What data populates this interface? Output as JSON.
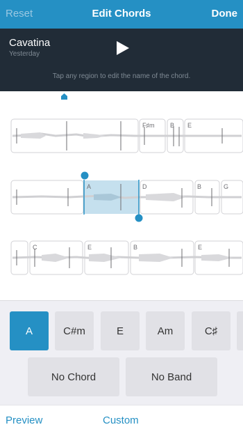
{
  "nav": {
    "reset_label": "Reset",
    "title": "Edit Chords",
    "done_label": "Done"
  },
  "player": {
    "song_title": "Cavatina",
    "song_subtitle": "Yesterday",
    "play_icon": "play-icon",
    "hint": "Tap any region to edit the name of the chord."
  },
  "waveform": {
    "rows": [
      {
        "segments": [
          {
            "label": ""
          },
          {
            "label": "F♯m"
          },
          {
            "label": "B"
          },
          {
            "label": "E"
          }
        ]
      },
      {
        "segments": [
          {
            "label": ""
          },
          {
            "label": "A",
            "selected": true
          },
          {
            "label": "D"
          },
          {
            "label": "B"
          },
          {
            "label": "G"
          }
        ]
      },
      {
        "segments": [
          {
            "label": ""
          },
          {
            "label": "C"
          },
          {
            "label": "E"
          },
          {
            "label": "B"
          },
          {
            "label": "E"
          }
        ]
      }
    ]
  },
  "picker": {
    "chords": [
      {
        "label": "A",
        "selected": true
      },
      {
        "label": "C#m"
      },
      {
        "label": "E"
      },
      {
        "label": "Am"
      },
      {
        "label": "C♯"
      }
    ],
    "no_chord_label": "No Chord",
    "no_band_label": "No Band"
  },
  "bottom": {
    "preview_label": "Preview",
    "custom_label": "Custom"
  },
  "colors": {
    "accent": "#2590c4",
    "selection": "#c5e0ee",
    "dark_panel": "#212c37",
    "waveform": "#cfcfd2"
  }
}
